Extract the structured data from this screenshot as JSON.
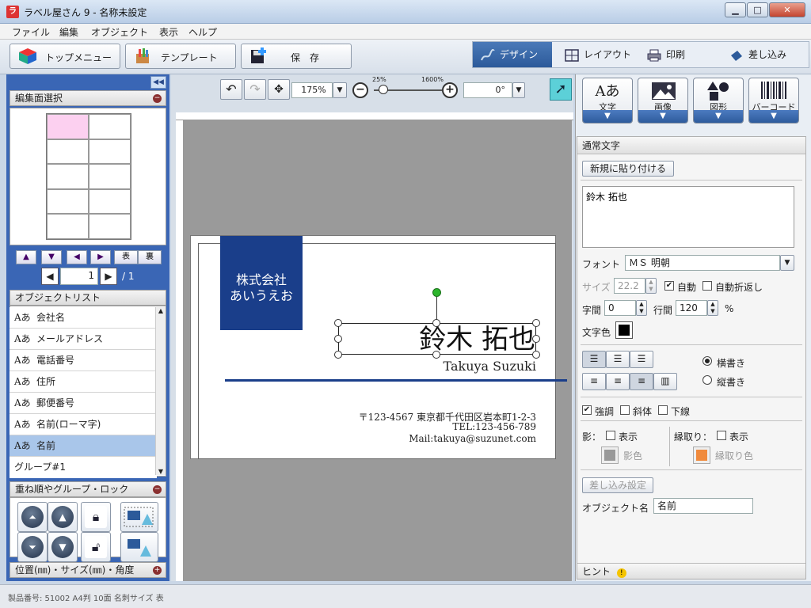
{
  "window": {
    "title": "ラベル屋さん 9 - 名称未設定",
    "min": "▁",
    "max": "□",
    "close": "✕"
  },
  "menu": [
    "ファイル",
    "編集",
    "オブジェクト",
    "表示",
    "ヘルプ"
  ],
  "toolbar": {
    "top_menu": "トップメニュー",
    "template": "テンプレート",
    "save": "保　存"
  },
  "modes": [
    {
      "label": "デザイン",
      "icon": "pen-icon",
      "active": true
    },
    {
      "label": "レイアウト",
      "icon": "layout-icon",
      "active": false
    },
    {
      "label": "印刷",
      "icon": "printer-icon",
      "active": false
    },
    {
      "label": "差し込み",
      "icon": "insert-icon",
      "active": false
    }
  ],
  "left": {
    "edit_face": "編集面選択",
    "nav": [
      "▲",
      "▼",
      "◀",
      "▶"
    ],
    "front": "表",
    "back": "裏",
    "page_current": "1",
    "page_total": "/ 1",
    "object_list_title": "オブジェクトリスト",
    "objects": [
      {
        "icon": "Aあ",
        "name": "会社名"
      },
      {
        "icon": "Aあ",
        "name": "メールアドレス"
      },
      {
        "icon": "Aあ",
        "name": "電話番号"
      },
      {
        "icon": "Aあ",
        "name": "住所"
      },
      {
        "icon": "Aあ",
        "name": "郵便番号"
      },
      {
        "icon": "Aあ",
        "name": "名前(ローマ字)"
      },
      {
        "icon": "Aあ",
        "name": "名前",
        "selected": true
      },
      {
        "icon": "",
        "name": "グループ#1"
      }
    ],
    "order_title": "重ね順やグループ・ロック",
    "position_title": "位置(㎜)・サイズ(㎜)・角度"
  },
  "zoom": {
    "value": "175%",
    "min_label": "25%",
    "max_label": "1600%",
    "angle": "0°"
  },
  "card": {
    "company": "株式会社\nあいうえお",
    "name": "鈴木 拓也",
    "romaji": "Takuya Suzuki",
    "address": "〒123-4567 東京都千代田区岩本町1-2-3",
    "tel": "TEL:123-456-789",
    "mail": "Mail:takuya@suzunet.com"
  },
  "insert_buttons": [
    {
      "label": "文字",
      "icon": "text-icon"
    },
    {
      "label": "画像",
      "icon": "image-icon"
    },
    {
      "label": "図形",
      "icon": "shape-icon"
    },
    {
      "label": "バーコード",
      "icon": "barcode-icon"
    }
  ],
  "props": {
    "title": "通常文字",
    "paste_new": "新規に貼り付ける",
    "text_value": "鈴木 拓也",
    "font_label": "フォント",
    "font_value": "ＭＳ 明朝",
    "size_label": "サイズ",
    "size_value": "22.2",
    "auto": "自動",
    "auto_wrap": "自動折返し",
    "char_spacing_label": "字間",
    "char_spacing": "0",
    "line_spacing_label": "行間",
    "line_spacing": "120",
    "percent": "%",
    "color_label": "文字色",
    "horizontal": "横書き",
    "vertical": "縦書き",
    "bold": "強調",
    "italic": "斜体",
    "underline": "下線",
    "shadow_label": "影：",
    "shadow_show": "表示",
    "shadow_color": "影色",
    "outline_label": "縁取り：",
    "outline_show": "表示",
    "outline_color": "縁取り色",
    "merge_setting": "差し込み設定",
    "object_name_label": "オブジェクト名",
    "object_name": "名前",
    "hint": "ヒント"
  },
  "status": "製品番号: 51002 A4判 10面 名刺サイズ 表"
}
